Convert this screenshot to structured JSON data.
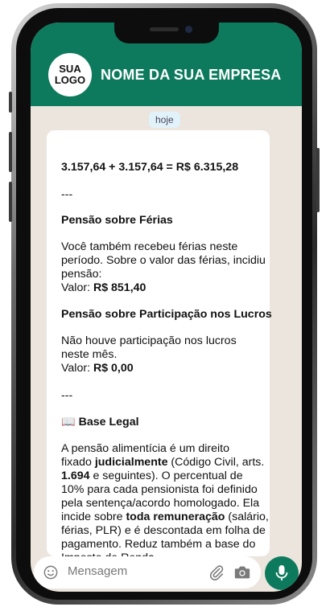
{
  "header": {
    "logo_line1": "SUA",
    "logo_line2": "LOGO",
    "company_name": "NOME DA SUA EMPRESA"
  },
  "chat": {
    "date_chip": "hoje",
    "message": {
      "sum_line": "3.157,64 + 3.157,64 = R$ 6.315,28",
      "divider1": "---",
      "section1_title": "Pensão sobre Férias",
      "section1_l1": "Você também recebeu férias neste",
      "section1_l2": "período. Sobre o valor das férias, incidiu",
      "section1_l3": "pensão:",
      "section1_value_label": "Valor: ",
      "section1_value": "R$ 851,40",
      "section2_title": "Pensão sobre Participação nos Lucros",
      "section2_l1": "Não houve participação nos lucros",
      "section2_l2": "neste mês.",
      "section2_value_label": "Valor: ",
      "section2_value": "R$ 0,00",
      "divider2": "---",
      "base_icon": "📖",
      "base_title": "Base Legal",
      "base_l1": "A pensão alimentícia é um direito",
      "base_l2_a": "fixado ",
      "base_l2_b": "judicialmente",
      "base_l2_c": " (Código Civil, arts.",
      "base_l3_a": "1.694",
      "base_l3_b": " e seguintes). O percentual de",
      "base_l4": "10% para cada pensionista foi definido",
      "base_l5": "pela sentença/acordo homologado. Ela",
      "base_l6_a": "incide sobre ",
      "base_l6_b": "toda remuneração",
      "base_l6_c": " (salário,",
      "base_l7": "férias, PLR) e é descontada em folha de",
      "base_l8": "pagamento. Reduz também a base do",
      "base_l9": "Imposto de Renda."
    }
  },
  "input": {
    "placeholder": "Mensagem",
    "icons": [
      "emoji-icon",
      "paperclip-icon",
      "camera-icon",
      "microphone-icon"
    ]
  },
  "colors": {
    "header_green": "#0e7a5d",
    "chat_background": "#ece5dd",
    "bubble": "#ffffff",
    "date_chip": "#e1f2fb"
  }
}
